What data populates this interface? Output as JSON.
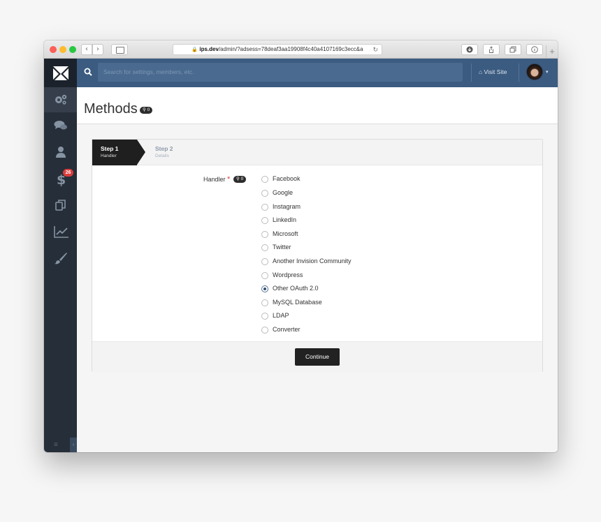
{
  "browser": {
    "back_glyph": "‹",
    "forward_glyph": "›",
    "address_domain": "ips.dev",
    "address_path": "/admin/?adsess=78deaf3aa19908f4c40a4107169c3ecc&a",
    "reload_glyph": "↻",
    "new_tab_glyph": "+"
  },
  "sidebar": {
    "items": [
      {
        "icon": "gears-icon",
        "active": true
      },
      {
        "icon": "chat-icon"
      },
      {
        "icon": "user-icon"
      },
      {
        "icon": "dollar-icon",
        "badge": "26"
      },
      {
        "icon": "copy-icon"
      },
      {
        "icon": "chart-icon"
      },
      {
        "icon": "brush-icon"
      }
    ],
    "menu_glyph": "≡",
    "toggle_glyph": "›"
  },
  "header": {
    "search_placeholder": "Search for settings, members, etc.",
    "visit_site": "Visit Site",
    "avatar_caret": "▾"
  },
  "page": {
    "title": "Methods",
    "title_pill": "0"
  },
  "wizard": {
    "steps": [
      {
        "title": "Step 1",
        "subtitle": "Handler",
        "active": true
      },
      {
        "title": "Step 2",
        "subtitle": "Details",
        "active": false
      }
    ]
  },
  "form": {
    "handler_label": "Handler",
    "required_mark": "*",
    "handler_pill": "0",
    "options": [
      "Facebook",
      "Google",
      "Instagram",
      "LinkedIn",
      "Microsoft",
      "Twitter",
      "Another Invision Community",
      "Wordpress",
      "Other OAuth 2.0",
      "MySQL Database",
      "LDAP",
      "Converter"
    ],
    "selected": "Other OAuth 2.0",
    "continue_label": "Continue"
  },
  "colors": {
    "header_bg": "#3b5b80",
    "sidebar_bg": "#262e39",
    "badge": "#dc3c3c",
    "button": "#222222"
  }
}
